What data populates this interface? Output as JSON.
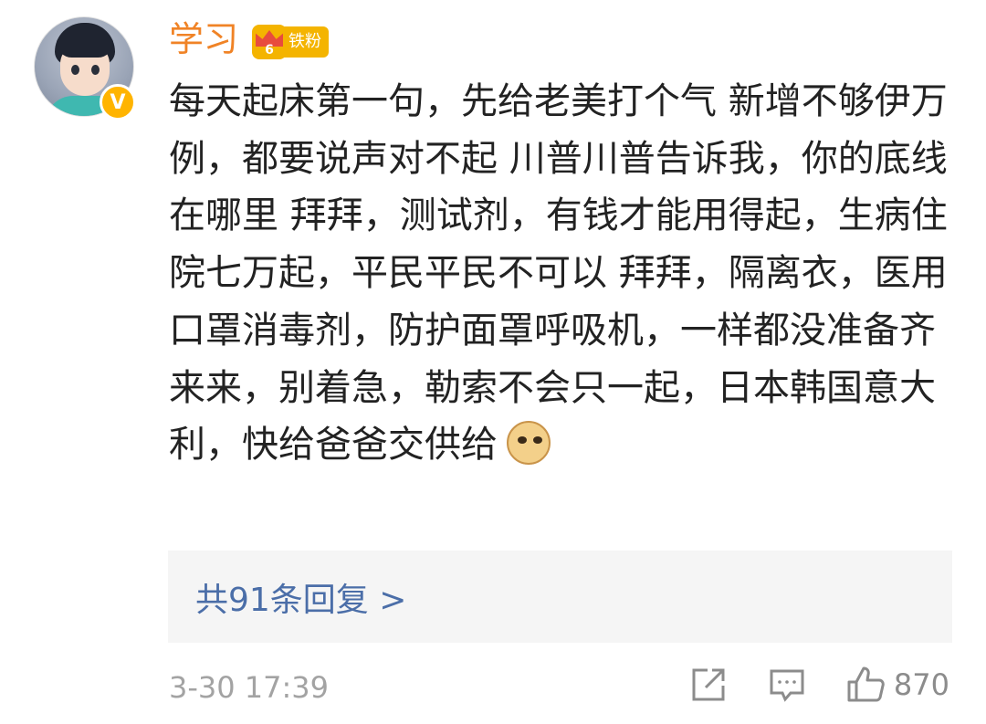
{
  "user": {
    "name": "学习",
    "fan_badge_level": "6",
    "fan_badge_text": "铁粉",
    "verified_mark": "V"
  },
  "comment": {
    "text": "每天起床第一句，先给老美打个气 新增不够伊万例，都要说声对不起 川普川普告诉我，你的底线在哪里 拜拜，测试剂，有钱才能用得起，生病住院七万起，平民平民不可以 拜拜，隔离衣，医用口罩消毒剂，防护面罩呼吸机，一样都没准备齐来来，别着急，勒索不会只一起，日本韩国意大利，快给爸爸交供给",
    "emoji": "doge"
  },
  "replies": {
    "label": "共91条回复 >"
  },
  "footer": {
    "timestamp": "3-30 17:39",
    "like_count": "870"
  },
  "colors": {
    "username": "#f08326",
    "reply_link": "#4b6ea8",
    "badge": "#f4b400",
    "verified": "#ffb400"
  },
  "icons": [
    "share-icon",
    "reply-icon",
    "like-icon"
  ]
}
